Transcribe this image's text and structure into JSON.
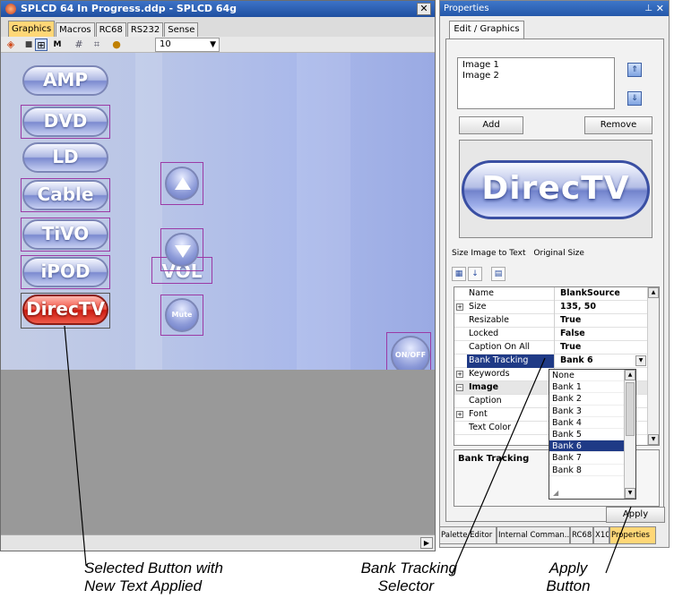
{
  "editor": {
    "title": "SPLCD 64 In Progress.ddp - SPLCD 64g",
    "close_glyph": "✕",
    "tabs": [
      {
        "label": "Graphics",
        "active": true
      },
      {
        "label": "Macros",
        "active": false
      },
      {
        "label": "RC68",
        "active": false
      },
      {
        "label": "RS232",
        "active": false
      },
      {
        "label": "Sense",
        "active": false
      }
    ],
    "toolbar": {
      "icons": [
        "paint-icon",
        "lock-icon",
        "snap-grid-icon",
        "merge-icon",
        "grid-icon",
        "grid-move-icon",
        "palette-icon"
      ],
      "grid_size": "10"
    },
    "canvas": {
      "source_buttons": [
        "AMP",
        "DVD",
        "LD",
        "Cable",
        "TiVO",
        "iPOD",
        "DirecTV"
      ],
      "selected_button": "DirecTV",
      "volume_label": "VOL",
      "mute_label": "Mute",
      "power_label": "ON/OFF"
    }
  },
  "properties": {
    "title": "Properties",
    "pin_glyph": "⊥",
    "close_glyph": "✕",
    "tab": "Edit / Graphics",
    "images": [
      "Image 1",
      "Image 2"
    ],
    "add_label": "Add",
    "remove_label": "Remove",
    "preview_text": "DirecTV",
    "size_image_to_text": "Size Image to Text",
    "original_size": "Original Size",
    "grid_rows": [
      {
        "name": "Name",
        "value": "BlankSource",
        "expander": ""
      },
      {
        "name": "Size",
        "value": "135, 50",
        "expander": "+"
      },
      {
        "name": "Resizable",
        "value": "True",
        "expander": ""
      },
      {
        "name": "Locked",
        "value": "False",
        "expander": ""
      },
      {
        "name": "Caption On All Images",
        "value": "True",
        "expander": ""
      },
      {
        "name": "Bank Tracking",
        "value": "Bank 6",
        "expander": ""
      },
      {
        "name": "Keywords",
        "value": "",
        "expander": "+"
      },
      {
        "name": "Image",
        "value": "",
        "expander": "−"
      },
      {
        "name": "Caption",
        "value": "",
        "expander": ""
      },
      {
        "name": "Font",
        "value": "",
        "expander": "+"
      },
      {
        "name": "Text Color",
        "value": "",
        "expander": ""
      }
    ],
    "bank_options": [
      "None",
      "Bank 1",
      "Bank 2",
      "Bank 3",
      "Bank 4",
      "Bank 5",
      "Bank 6",
      "Bank 7",
      "Bank 8"
    ],
    "bank_selected": "Bank 6",
    "description_title": "Bank Tracking",
    "apply_label": "Apply",
    "bottom_tabs": [
      {
        "label": "Palette Editor",
        "active": false
      },
      {
        "label": "Internal Comman...",
        "active": false
      },
      {
        "label": "RC68",
        "active": false
      },
      {
        "label": "X10",
        "active": false
      },
      {
        "label": "Properties",
        "active": true
      }
    ]
  },
  "callouts": {
    "selected_button": [
      "Selected Button with",
      "New Text Applied"
    ],
    "bank_tracking": [
      "Bank Tracking",
      "Selector"
    ],
    "apply_button": [
      "Apply",
      "Button"
    ]
  },
  "colors": {
    "title_bar": "#2458a9",
    "active_tab": "#ffd777",
    "selection": "#1f3a86",
    "selected_button": "#cc1a10"
  }
}
